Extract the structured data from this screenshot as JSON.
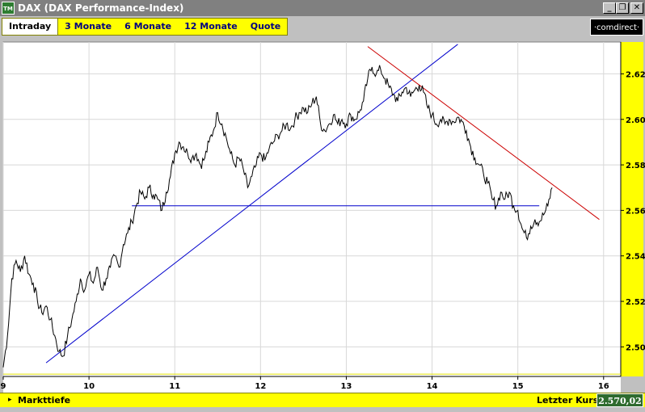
{
  "window": {
    "app_icon": "TM",
    "title": "DAX (DAX Performance-Index)",
    "min_glyph": "_",
    "max_glyph": "❐",
    "close_glyph": "✕"
  },
  "tabs": [
    {
      "label": "Intraday",
      "active": true
    },
    {
      "label": "3 Monate",
      "active": false
    },
    {
      "label": "6 Monate",
      "active": false
    },
    {
      "label": "12 Monate",
      "active": false
    },
    {
      "label": "Quote",
      "active": false
    }
  ],
  "brand": {
    "label": "·comdirect·"
  },
  "footer": {
    "arrow": "▸",
    "depth_label": "Markttiefe",
    "last_price_label": "Letzter Kurs",
    "last_price_value": "2.570,02"
  },
  "colors": {
    "price_line": "#000000",
    "support_line": "#0000cc",
    "resistance_line": "#cc0000",
    "reference_line": "#e0e000",
    "panel_bg": "#ffffff",
    "accent": "#ffff00"
  },
  "chart_data": {
    "type": "line",
    "x_ticks": [
      "9",
      "10",
      "11",
      "12",
      "13",
      "14",
      "15",
      "16"
    ],
    "y_ticks": [
      "2.500",
      "2.520",
      "2.540",
      "2.560",
      "2.580",
      "2.600",
      "2.620"
    ],
    "xlim": [
      9,
      16.2
    ],
    "ylim": [
      2487,
      2634
    ],
    "grid": true,
    "series": [
      {
        "values": [
          [
            9.0,
            2491
          ],
          [
            9.05,
            2505
          ],
          [
            9.1,
            2530
          ],
          [
            9.15,
            2538
          ],
          [
            9.2,
            2533
          ],
          [
            9.25,
            2540
          ],
          [
            9.3,
            2532
          ],
          [
            9.35,
            2528
          ],
          [
            9.4,
            2520
          ],
          [
            9.45,
            2515
          ],
          [
            9.5,
            2518
          ],
          [
            9.55,
            2512
          ],
          [
            9.6,
            2505
          ],
          [
            9.65,
            2498
          ],
          [
            9.7,
            2496
          ],
          [
            9.75,
            2505
          ],
          [
            9.8,
            2512
          ],
          [
            9.85,
            2520
          ],
          [
            9.9,
            2530
          ],
          [
            9.95,
            2525
          ],
          [
            10.0,
            2532
          ],
          [
            10.05,
            2528
          ],
          [
            10.1,
            2535
          ],
          [
            10.15,
            2525
          ],
          [
            10.2,
            2530
          ],
          [
            10.25,
            2535
          ],
          [
            10.3,
            2540
          ],
          [
            10.35,
            2535
          ],
          [
            10.4,
            2545
          ],
          [
            10.45,
            2550
          ],
          [
            10.5,
            2555
          ],
          [
            10.55,
            2562
          ],
          [
            10.6,
            2568
          ],
          [
            10.65,
            2565
          ],
          [
            10.7,
            2570
          ],
          [
            10.75,
            2567
          ],
          [
            10.8,
            2565
          ],
          [
            10.85,
            2560
          ],
          [
            10.9,
            2568
          ],
          [
            10.95,
            2575
          ],
          [
            11.0,
            2585
          ],
          [
            11.05,
            2590
          ],
          [
            11.1,
            2588
          ],
          [
            11.15,
            2585
          ],
          [
            11.2,
            2583
          ],
          [
            11.25,
            2585
          ],
          [
            11.3,
            2580
          ],
          [
            11.35,
            2583
          ],
          [
            11.4,
            2590
          ],
          [
            11.45,
            2595
          ],
          [
            11.5,
            2603
          ],
          [
            11.55,
            2598
          ],
          [
            11.6,
            2592
          ],
          [
            11.65,
            2585
          ],
          [
            11.7,
            2580
          ],
          [
            11.75,
            2583
          ],
          [
            11.8,
            2578
          ],
          [
            11.85,
            2570
          ],
          [
            11.9,
            2575
          ],
          [
            11.95,
            2580
          ],
          [
            12.0,
            2585
          ],
          [
            12.05,
            2582
          ],
          [
            12.1,
            2587
          ],
          [
            12.15,
            2590
          ],
          [
            12.2,
            2593
          ],
          [
            12.25,
            2595
          ],
          [
            12.3,
            2598
          ],
          [
            12.35,
            2596
          ],
          [
            12.4,
            2600
          ],
          [
            12.45,
            2603
          ],
          [
            12.5,
            2605
          ],
          [
            12.55,
            2603
          ],
          [
            12.6,
            2607
          ],
          [
            12.65,
            2610
          ],
          [
            12.7,
            2598
          ],
          [
            12.75,
            2595
          ],
          [
            12.8,
            2598
          ],
          [
            12.85,
            2602
          ],
          [
            12.9,
            2598
          ],
          [
            12.95,
            2600
          ],
          [
            13.0,
            2598
          ],
          [
            13.05,
            2602
          ],
          [
            13.1,
            2600
          ],
          [
            13.15,
            2603
          ],
          [
            13.2,
            2608
          ],
          [
            13.25,
            2618
          ],
          [
            13.3,
            2623
          ],
          [
            13.35,
            2620
          ],
          [
            13.4,
            2622
          ],
          [
            13.45,
            2618
          ],
          [
            13.5,
            2614
          ],
          [
            13.55,
            2611
          ],
          [
            13.6,
            2608
          ],
          [
            13.65,
            2612
          ],
          [
            13.7,
            2614
          ],
          [
            13.75,
            2610
          ],
          [
            13.8,
            2613
          ],
          [
            13.85,
            2615
          ],
          [
            13.9,
            2612
          ],
          [
            13.95,
            2605
          ],
          [
            14.0,
            2602
          ],
          [
            14.05,
            2598
          ],
          [
            14.1,
            2600
          ],
          [
            14.15,
            2598
          ],
          [
            14.2,
            2600
          ],
          [
            14.25,
            2599
          ],
          [
            14.3,
            2601
          ],
          [
            14.35,
            2599
          ],
          [
            14.4,
            2595
          ],
          [
            14.45,
            2588
          ],
          [
            14.5,
            2583
          ],
          [
            14.55,
            2580
          ],
          [
            14.6,
            2576
          ],
          [
            14.65,
            2572
          ],
          [
            14.7,
            2565
          ],
          [
            14.75,
            2562
          ],
          [
            14.8,
            2568
          ],
          [
            14.85,
            2565
          ],
          [
            14.9,
            2568
          ],
          [
            14.95,
            2562
          ],
          [
            15.0,
            2560
          ],
          [
            15.05,
            2552
          ],
          [
            15.1,
            2548
          ],
          [
            15.15,
            2553
          ],
          [
            15.2,
            2556
          ],
          [
            15.25,
            2555
          ],
          [
            15.3,
            2558
          ],
          [
            15.35,
            2562
          ],
          [
            15.4,
            2570
          ]
        ]
      }
    ],
    "trendlines": [
      {
        "color": "#0000cc",
        "from": [
          9.5,
          2493
        ],
        "to": [
          14.3,
          2633
        ]
      },
      {
        "color": "#0000cc",
        "from": [
          10.5,
          2562
        ],
        "to": [
          15.25,
          2562
        ]
      },
      {
        "color": "#cc0000",
        "from": [
          13.25,
          2632
        ],
        "to": [
          15.95,
          2556
        ]
      },
      {
        "color": "#e0e000",
        "from": [
          9.0,
          2488
        ],
        "to": [
          16.2,
          2488
        ]
      }
    ]
  }
}
